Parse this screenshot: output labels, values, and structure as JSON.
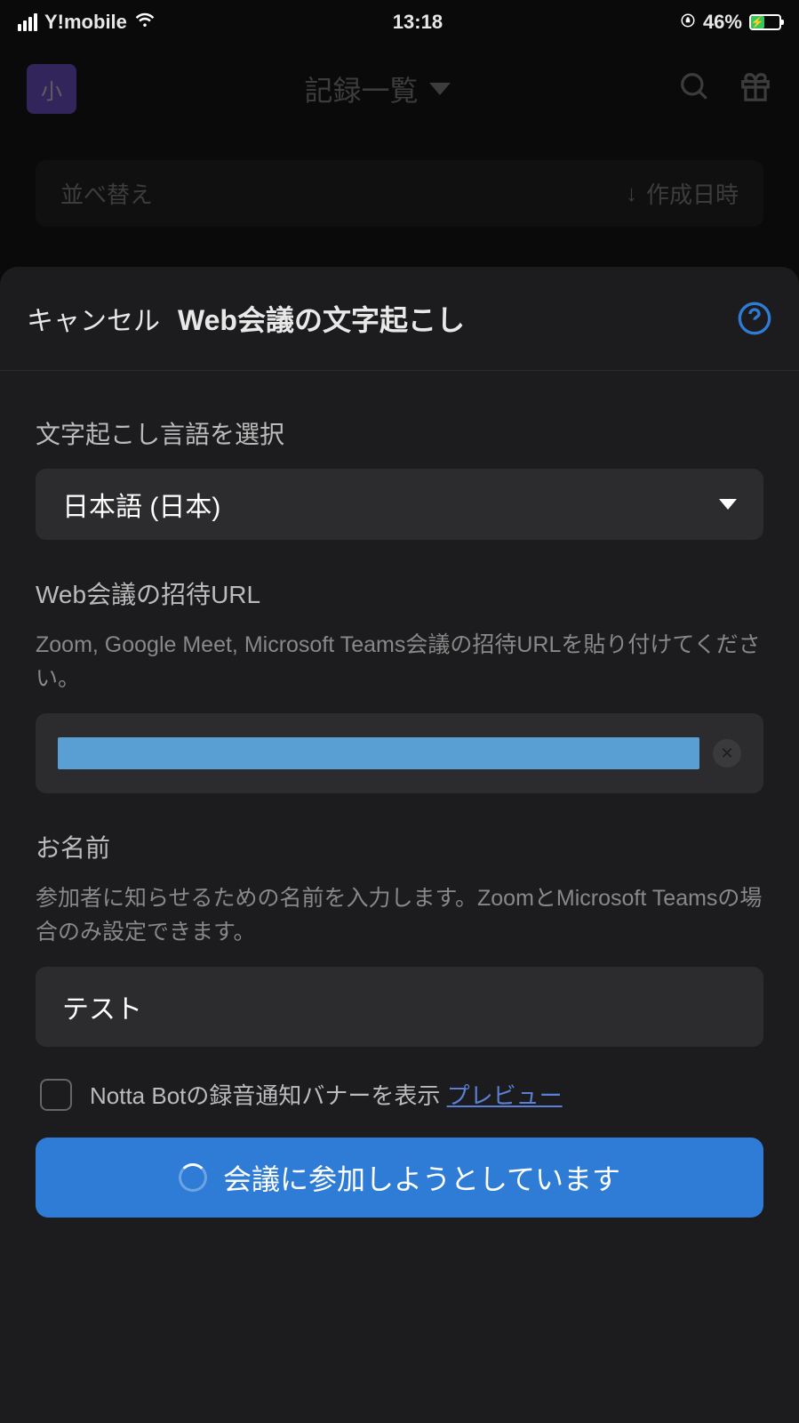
{
  "status": {
    "carrier": "Y!mobile",
    "time": "13:18",
    "battery": "46%"
  },
  "header": {
    "avatar_text": "小",
    "title": "記録一覧"
  },
  "sort": {
    "label": "並べ替え",
    "value": "作成日時"
  },
  "modal": {
    "cancel": "キャンセル",
    "title": "Web会議の文字起こし",
    "language": {
      "label": "文字起こし言語を選択",
      "value": "日本語 (日本)"
    },
    "url": {
      "label": "Web会議の招待URL",
      "sublabel": "Zoom, Google Meet, Microsoft Teams会議の招待URLを貼り付けてください。"
    },
    "name": {
      "label": "お名前",
      "sublabel": "参加者に知らせるための名前を入力します。ZoomとMicrosoft Teamsの場合のみ設定できます。",
      "value": "テスト"
    },
    "banner": {
      "label": "Notta Botの録音通知バナーを表示 ",
      "preview": "プレビュー"
    },
    "button": "会議に参加しようとしています"
  }
}
